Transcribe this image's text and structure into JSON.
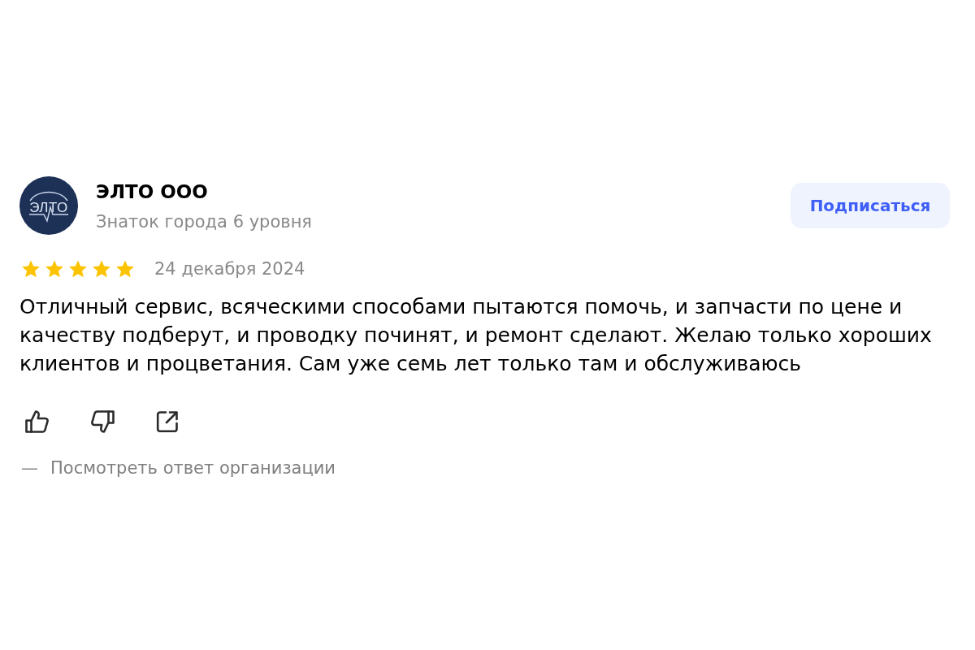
{
  "review": {
    "author": {
      "logo_text": "ЭЛТО",
      "name": "ЭЛТО ООО",
      "subtitle": "Знаток города 6 уровня"
    },
    "subscribe_button": "Подписаться",
    "stars": 5,
    "date": "24 декабря 2024",
    "text": "Отличный сервис, всяческими способами пытаются помочь, и запчасти по цене и качеству подберут, и проводку починят, и ремонт сделают. Желаю только хороших клиентов и процветания. Сам уже семь лет только там и обслуживаюсь",
    "actions": [
      {
        "kind": "like"
      },
      {
        "kind": "dislike"
      },
      {
        "kind": "share"
      }
    ],
    "reply_link": {
      "dash": "—",
      "label": "Посмотреть ответ организации"
    }
  }
}
